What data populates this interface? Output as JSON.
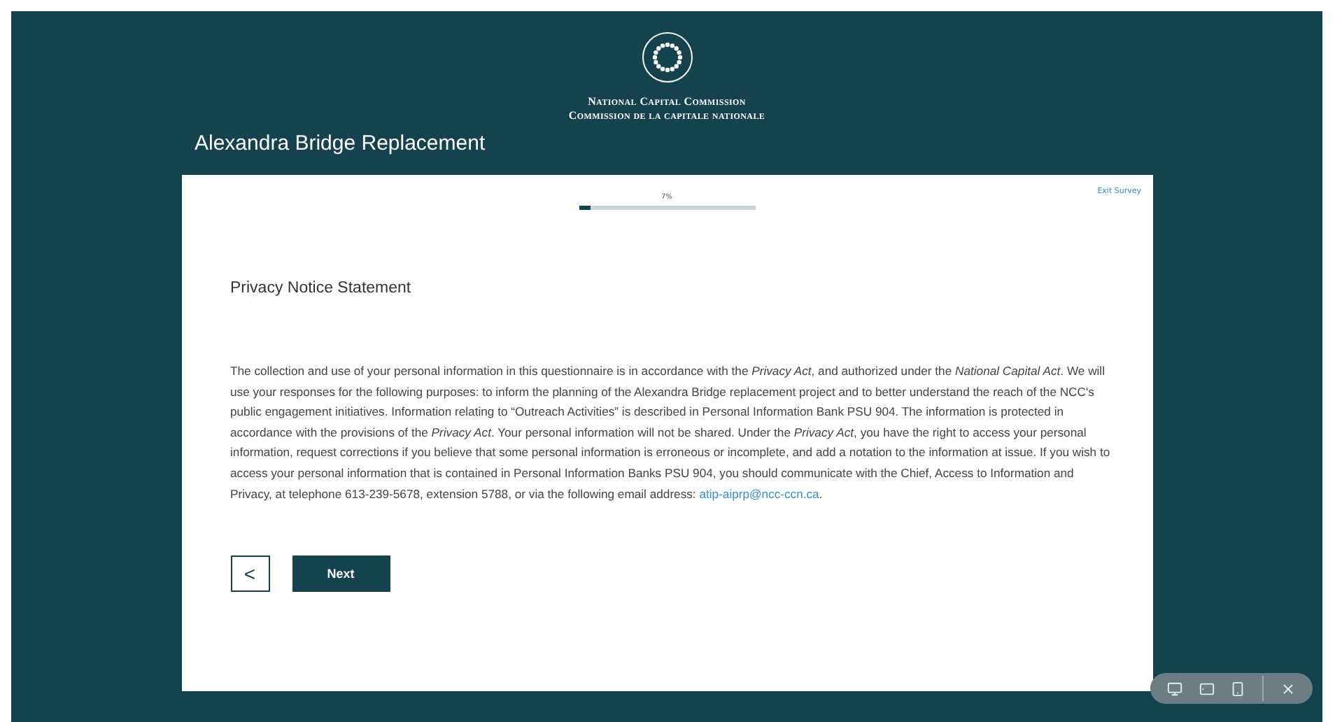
{
  "header": {
    "org_en": "National Capital Commission",
    "org_fr": "Commission de la capitale nationale"
  },
  "survey_title": "Alexandra Bridge Replacement",
  "progress": {
    "reading": "7%",
    "level": 0.07
  },
  "exit_link": "Exit Survey",
  "section_heading": "Privacy Notice Statement",
  "notice": {
    "text": "The collection and use of your personal information in this questionnaire is in accordance with the *Privacy Act*, and authorized under the *National Capital Act*. We will use your responses for the following purposes: to inform the planning of the Alexandra Bridge replacement project and to better understand the reach of the NCC's public engagement initiatives. Information relating to “Outreach Activities” is described in Personal Information Bank PSU 904. The information is protected in accordance with the provisions of the *Privacy Act*. Your personal information will not be shared. Under the *Privacy Act*, you have the right to access your personal information, request corrections if you believe that some personal information is erroneous or incomplete, and add a notation to the information at issue. If you wish to access your personal information that is contained in Personal Information Banks PSU 904, you should communicate with the Chief, Access to Information and Privacy, at telephone 613-239-5678, extension 5788, or via the following email address: ",
    "email": "atip-aiprp@ncc-ccn.ca",
    "end": "."
  },
  "buttons": {
    "back": "<",
    "next": "Next"
  }
}
